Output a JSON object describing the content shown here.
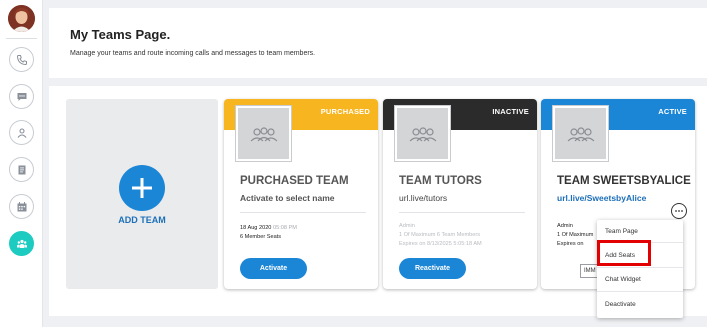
{
  "header": {
    "title": "My Teams Page.",
    "subtitle": "Manage your teams and route incoming calls and messages to team members."
  },
  "sidebar": {
    "items": [
      {
        "icon": "phone-icon"
      },
      {
        "icon": "chat-icon"
      },
      {
        "icon": "person-icon"
      },
      {
        "icon": "document-icon"
      },
      {
        "icon": "calendar-icon"
      },
      {
        "icon": "team-icon",
        "active": true
      }
    ]
  },
  "add_team": {
    "label": "ADD TEAM"
  },
  "cards": [
    {
      "status": "PURCHASED",
      "band_color": "#f7b520",
      "name": "PURCHASED TEAM",
      "subtitle": "Activate to select name",
      "date": "18 Aug 2020",
      "time": "05:08 PM",
      "seats": "6 Member Seats",
      "button": "Activate"
    },
    {
      "status": "INACTIVE",
      "band_color": "#2b2b2b",
      "name": "TEAM TUTORS",
      "url": "url.live/tutors",
      "role": "Admin",
      "members": "1 Of Maximum 6 Team Members",
      "expires": "Expires on 8/13/2025 5:05:18 AM",
      "button": "Reactivate"
    },
    {
      "status": "ACTIVE",
      "band_color": "#1c86d6",
      "name": "TEAM SWEETSBYALICE",
      "url": "url.live/SweetsbyAlice",
      "role": "Admin",
      "members": "1 Of Maximum",
      "expires": "Expires on",
      "button": "IMM"
    }
  ],
  "menu": {
    "items": [
      "Team Page",
      "Add Seats",
      "Chat Widget",
      "Deactivate"
    ],
    "highlighted": "Add Seats"
  },
  "colors": {
    "accent": "#1c86d6",
    "active_nav": "#1ecbc0",
    "highlight": "#e30000"
  }
}
